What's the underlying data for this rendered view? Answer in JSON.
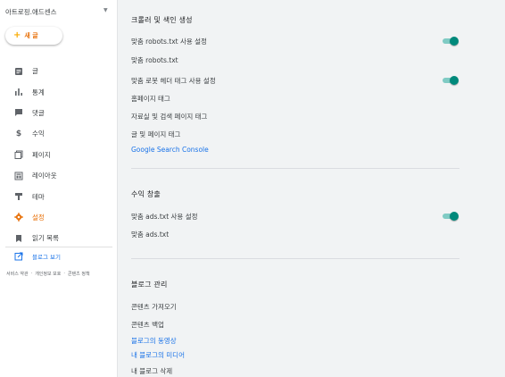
{
  "sidebar": {
    "blog_name": "아트로핑.애드센스",
    "new_button_label": "새 글",
    "items": [
      {
        "label": "글",
        "icon": "posts-icon"
      },
      {
        "label": "통계",
        "icon": "stats-icon"
      },
      {
        "label": "댓글",
        "icon": "comments-icon"
      },
      {
        "label": "수익",
        "icon": "dollar-icon"
      },
      {
        "label": "페이지",
        "icon": "pages-icon"
      },
      {
        "label": "레이아웃",
        "icon": "layout-icon"
      },
      {
        "label": "테마",
        "icon": "theme-icon"
      },
      {
        "label": "설정",
        "icon": "settings-icon",
        "active": true
      },
      {
        "label": "읽기 목록",
        "icon": "bookmark-icon"
      }
    ],
    "view_blog_label": "블로그 보기",
    "footer_links": [
      "서비스 약관",
      "·",
      "개인정보 보호",
      "·",
      "콘텐츠 정책"
    ]
  },
  "main": {
    "crawler_section": {
      "title": "크롤러 및 색인 생성",
      "rows": [
        {
          "label": "맞춤 robots.txt 사용 설정",
          "toggle": true
        },
        {
          "label": "맞춤 robots.txt"
        },
        {
          "label": "맞춤 로봇 헤더 태그 사용 설정",
          "toggle": true
        },
        {
          "label": "홈페이지 태그"
        },
        {
          "label": "자료실 및 검색 페이지 태그"
        },
        {
          "label": "글 및 페이지 태그"
        },
        {
          "label": "Google Search Console",
          "link": true
        }
      ]
    },
    "monetization_section": {
      "title": "수익 창출",
      "rows": [
        {
          "label": "맞춤 ads.txt 사용 설정",
          "toggle": true
        },
        {
          "label": "맞춤 ads.txt"
        }
      ]
    },
    "manage_section": {
      "title": "블로그 관리",
      "rows": [
        {
          "label": "콘텐츠 가져오기"
        },
        {
          "label": "콘텐츠 백업"
        },
        {
          "label": "블로그의 동영상",
          "link": true
        },
        {
          "label": "내 블로그의 미디어",
          "link": true
        },
        {
          "label": "내 블로그 삭제"
        }
      ]
    }
  },
  "colors": {
    "accent_orange": "#e8710a",
    "link_blue": "#1a73e8",
    "toggle_teal": "#00897b"
  }
}
